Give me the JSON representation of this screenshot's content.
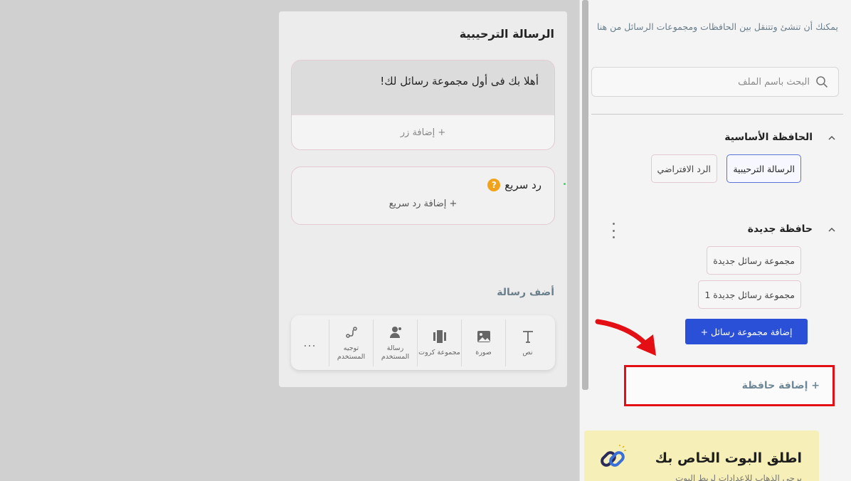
{
  "sidebar": {
    "intro": "يمكنك أن تنشئ وتتنقل بين الحافظات ومجموعات الرسائل من هنا",
    "search_placeholder": "البحث باسم الملف",
    "folders": [
      {
        "title": "الحافظة الأساسية",
        "items": [
          "الرسالة الترحيبية",
          "الرد الافتراضي"
        ]
      },
      {
        "title": "حافظة جديدة",
        "items": [
          "مجموعة رسائل جديدة",
          "مجموعة رسائل جديدة 1"
        ]
      }
    ],
    "add_group_label": "إضافة مجموعة رسائل +",
    "add_folder_label": "+ إضافة حافظة",
    "launch": {
      "title": "اطلق البوت الخاص بك",
      "subtitle": "برجى الذهاب للإعدادات لربط البوت"
    }
  },
  "panel": {
    "title": "الرسالة الترحيبية",
    "message_text": "أهلا بك فى أول مجموعة رسائل لك!",
    "add_button_label": "+ إضافة زر",
    "quick_reply_title": "رد سريع",
    "add_quick_reply_label": "+ إضافة رد سريع",
    "add_message_label": "أضف رسالة",
    "tools": [
      {
        "label": "نص",
        "icon": "text-icon"
      },
      {
        "label": "صورة",
        "icon": "image-icon"
      },
      {
        "label": "مجموعة كروت",
        "icon": "cards-icon"
      },
      {
        "label": "رسالة المستخدم",
        "icon": "user-message-icon"
      },
      {
        "label": "توجيه المستخدم",
        "icon": "redirect-icon"
      }
    ],
    "more_label": "..."
  },
  "colors": {
    "primary": "#2b50d8",
    "highlight": "#e30f14",
    "arrow": "#e30f14",
    "launch_bg": "#f7efb8",
    "help": "#f2a31b"
  }
}
